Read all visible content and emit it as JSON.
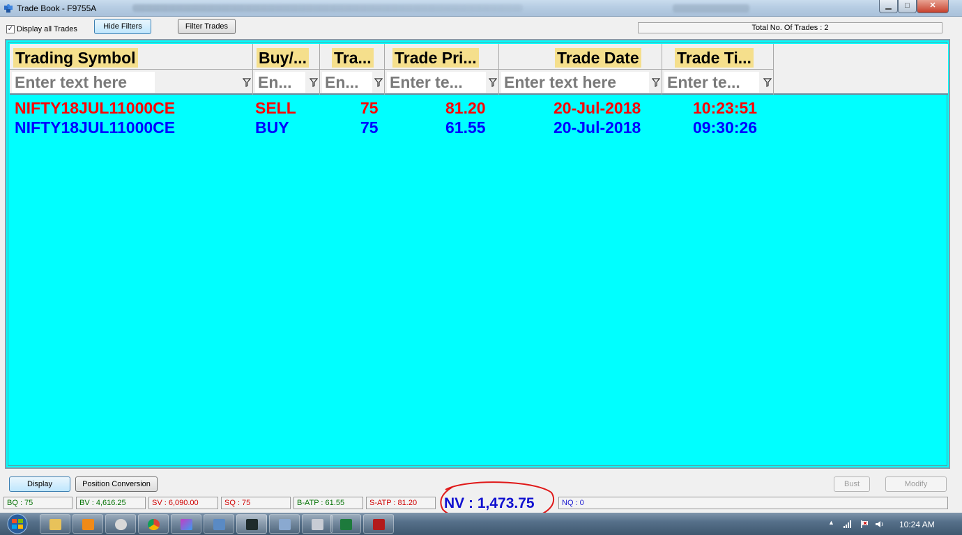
{
  "window": {
    "title": "Trade Book - F9755A",
    "min_glyph": "▁",
    "max_glyph": "□",
    "close_glyph": "✕"
  },
  "toolbar": {
    "display_all_checked": true,
    "check_glyph": "✓",
    "display_all_label": "Display all Trades",
    "hide_filters_label": "Hide Filters",
    "filter_trades_label": "Filter Trades",
    "total_trades_text": "Total No. Of Trades : 2"
  },
  "grid": {
    "background_color": "#00ffff",
    "header_highlight_color": "#f5df8c",
    "columns": [
      {
        "label": "Trading Symbol",
        "filter_placeholder": "Enter text here"
      },
      {
        "label": "Buy/...",
        "filter_placeholder": "En..."
      },
      {
        "label": "Tra...",
        "filter_placeholder": "En..."
      },
      {
        "label": "Trade Pri...",
        "filter_placeholder": "Enter te..."
      },
      {
        "label": "Trade Date",
        "filter_placeholder": "Enter text here"
      },
      {
        "label": "Trade Ti...",
        "filter_placeholder": "Enter te..."
      }
    ],
    "rows": [
      {
        "symbol": "NIFTY18JUL11000CE",
        "side": "SELL",
        "qty": "75",
        "price": "81.20",
        "date": "20-Jul-2018",
        "time": "10:23:51",
        "color": "#ff0000"
      },
      {
        "symbol": "NIFTY18JUL11000CE",
        "side": "BUY",
        "qty": "75",
        "price": "61.55",
        "date": "20-Jul-2018",
        "time": "09:30:26",
        "color": "#0000ff"
      }
    ]
  },
  "actions": {
    "display_label": "Display",
    "position_conversion_label": "Position Conversion",
    "bust_label": "Bust",
    "modify_label": "Modify"
  },
  "status": {
    "bq": "BQ : 75",
    "bv": "BV : 4,616.25",
    "sv": "SV : 6,090.00",
    "sq": "SQ : 75",
    "batp": "B-ATP : 61.55",
    "satp": "S-ATP : 81.20",
    "nv": "NV : 1,473.75",
    "nq": "NQ : 0"
  },
  "taskbar": {
    "clock": "10:24 AM",
    "tray_up_glyph": "▲"
  },
  "icons": {
    "app": "puzzle-icon",
    "filter": "funnel-icon",
    "start": "windows-start-icon"
  }
}
